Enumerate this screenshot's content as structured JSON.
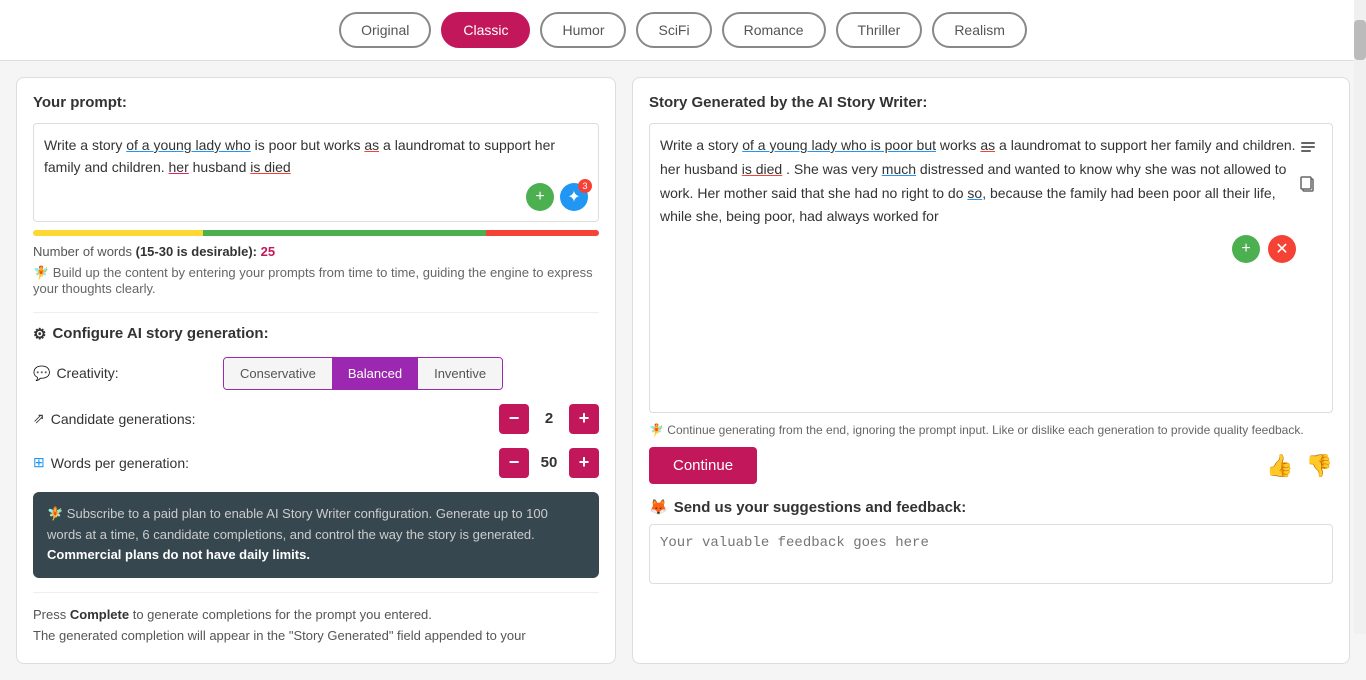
{
  "topBar": {
    "buttons": [
      {
        "label": "Original",
        "active": false
      },
      {
        "label": "Classic",
        "active": true
      },
      {
        "label": "Humor",
        "active": false
      },
      {
        "label": "SciFi",
        "active": false
      },
      {
        "label": "Romance",
        "active": false
      },
      {
        "label": "Thriller",
        "active": false
      },
      {
        "label": "Realism",
        "active": false
      }
    ]
  },
  "leftPanel": {
    "promptTitle": "Your prompt:",
    "promptText": "Write a story of a young lady who is poor but works as a laundromat to support her family and children. her husband is died",
    "wordCountLabel": "Number of words",
    "wordCountRange": "(15-30 is desirable):",
    "wordCountValue": "25",
    "hintText": "🧚 Build up the content by entering your prompts from time to time, guiding the engine to express your thoughts clearly.",
    "configureTitle": "Configure AI story generation:",
    "creativityLabel": "Creativity:",
    "creativityOptions": [
      "Conservative",
      "Balanced",
      "Inventive"
    ],
    "creativityActive": "Balanced",
    "candidateLabel": "Candidate generations:",
    "candidateValue": "2",
    "wordsLabel": "Words per generation:",
    "wordsValue": "50",
    "subscribeText": "🧚 Subscribe to a paid plan to enable AI Story Writer configuration. Generate up to 100 words at a time, 6 candidate completions, and control the way the story is generated.",
    "subscribeStrong": "Commercial plans do not have daily limits.",
    "pressCompleteText1": "Press",
    "pressCompleteStrong": "Complete",
    "pressCompleteText2": "to generate completions for the prompt you entered.",
    "pressCompleteText3": "The generated completion will appear in the \"Story Generated\" field appended to your"
  },
  "rightPanel": {
    "title": "Story Generated by the AI Story Writer:",
    "storyText": "Write a story of a young lady who is poor but works as a laundromat to support her family and children. her husband is died . She was very much distressed and wanted to know why she was not allowed to work. Her mother said that she had no right to do so, because the family had been poor all their life, while she, being poor, had always worked for",
    "hintText": "🧚 Continue generating from the end, ignoring the prompt input. Like or dislike each generation to provide quality feedback.",
    "continueBtn": "Continue",
    "feedbackTitle": "Send us your suggestions and feedback:",
    "feedbackEmoji": "🦊",
    "feedbackPlaceholder": "Your valuable feedback goes here"
  }
}
